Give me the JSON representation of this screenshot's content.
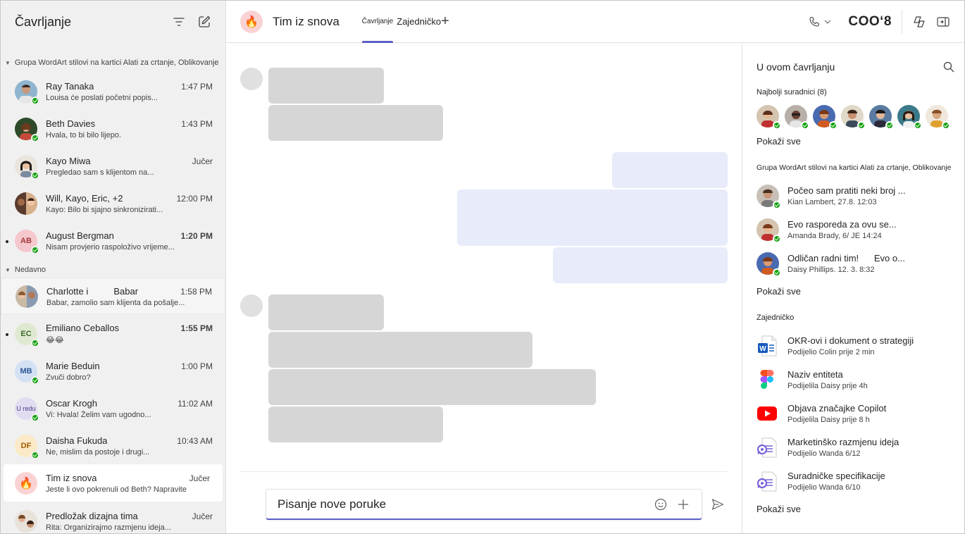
{
  "sidebar": {
    "title": "Čavrljanje",
    "sections": {
      "pinned": "Grupa WordArt stilovi na kartici Alati za crtanje, Oblikovanje",
      "recent": "Nedavno"
    },
    "chats": [
      {
        "name": "Ray Tanaka",
        "time": "1:47 PM",
        "preview": "Louisa će poslati početni popis...",
        "initials": ""
      },
      {
        "name": "Beth  Davies",
        "time": "1:43 PM",
        "preview": "Hvala, to bi bilo lijepo.",
        "initials": ""
      },
      {
        "name": "Kayo Miwa",
        "time": "Jučer",
        "preview": "Pregledao sam s klijentom na...",
        "initials": ""
      },
      {
        "name": "Will, Kayo, Eric, +2",
        "time": "12:00 PM",
        "preview": "Kayo: Bilo bi sjajno sinkronizirati...",
        "initials": ""
      },
      {
        "name": "August Bergman",
        "time": "1:20 PM",
        "preview": "Nisam provjerio raspoloživo vrijeme...",
        "initials": "AB"
      },
      {
        "name": "Charlotte i          Babar",
        "time": "1:58 PM",
        "preview": "Babar, zamolio sam klijenta da pošalje...",
        "initials": ""
      },
      {
        "name": "Emiliano Ceballos",
        "time": "1:55 PM",
        "preview": "😂😂",
        "initials": "EC"
      },
      {
        "name": "Marie Beduin",
        "time": "1:00 PM",
        "preview": "Zvuči dobro?",
        "initials": "MB"
      },
      {
        "name": "Oscar Krogh",
        "time": "11:02 AM",
        "preview": "Vi: Hvala! Želim vam ugodno...",
        "initials": "U redu"
      },
      {
        "name": "Daisha Fukuda",
        "time": "10:43 AM",
        "preview": "Ne, mislim da postoje i drugi...",
        "initials": "DF"
      },
      {
        "name": "Tim iz snova",
        "time": "Jučer",
        "preview": "Jeste li ovo pokrenuli od Beth? Napravite",
        "initials": ""
      },
      {
        "name": "Predložak dizajna tima",
        "time": "Jučer",
        "preview": "Rita: Organizirajmo razmjenu ideja...",
        "initials": ""
      }
    ]
  },
  "header": {
    "team_name": "Tim iz snova",
    "tab_chat": "Čavrljanje",
    "tab_shared": "Zajedničko",
    "brand": "COO‘8"
  },
  "compose": {
    "placeholder": "Pisanje nove poruke"
  },
  "panel": {
    "title": "U ovom čavrljanju",
    "top_collaborators": "Najbolji suradnici (8)",
    "show_all": "Pokaži sve",
    "group_section": "Grupa WordArt stilovi na kartici Alati za crtanje, Oblikovanje",
    "conversations": [
      {
        "title": "Počeo sam pratiti neki broj ...",
        "sub": "Kian Lambert, 27.8. 12:03"
      },
      {
        "title": "Evo rasporeda za ovu se...",
        "sub": "Amanda Brady, 6/ JE 14:24"
      },
      {
        "title": "Odličan radni tim!      Evo o...",
        "sub": "Daisy Phillips. 12. 3. 8:32"
      }
    ],
    "shared_section": "Zajedničko",
    "files": [
      {
        "title": "OKR-ovi i dokument o strategiji",
        "sub": "Podijelio Colin prije 2 min",
        "icon": "word-icon"
      },
      {
        "title": "Naziv entiteta",
        "sub": "Podijelila Daisy prije 4h",
        "icon": "figma-icon"
      },
      {
        "title": "Objava značajke Copilot",
        "sub": "Podijelila Daisy prije 8 h",
        "icon": "youtube-icon"
      },
      {
        "title": "Marketinško razmjenu ideja",
        "sub": "Podijelio Wanda 6/12",
        "icon": "loop-icon"
      },
      {
        "title": "Suradničke specifikacije",
        "sub": "Podijelio Wanda 6/10",
        "icon": "loop-icon"
      }
    ]
  },
  "colors": {
    "accent": "#5b5fc7",
    "presence": "#13a10e",
    "incoming_bubble": "#d6d6d6",
    "outgoing_bubble": "#e8ebfa"
  }
}
